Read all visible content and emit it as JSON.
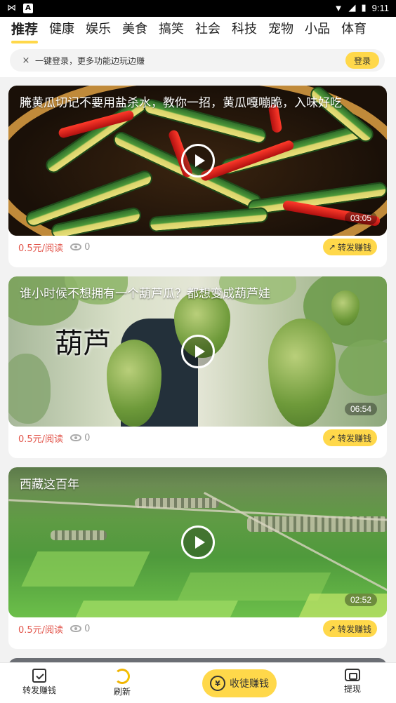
{
  "status_bar": {
    "time": "9:11"
  },
  "tabs": [
    {
      "label": "推荐",
      "active": true
    },
    {
      "label": "健康"
    },
    {
      "label": "娱乐"
    },
    {
      "label": "美食"
    },
    {
      "label": "搞笑"
    },
    {
      "label": "社会"
    },
    {
      "label": "科技"
    },
    {
      "label": "宠物"
    },
    {
      "label": "小品"
    },
    {
      "label": "体育"
    }
  ],
  "login_banner": {
    "close": "×",
    "text": "一键登录，更多功能边玩边赚",
    "button": "登录"
  },
  "cards": [
    {
      "title": "腌黄瓜切记不要用盐杀水，教你一招，黄瓜嘎嘣脆，入味好吃",
      "duration": "03:05",
      "price": "0.5元/阅读",
      "views": "0",
      "share": "转发赚钱"
    },
    {
      "title": "谁小时候不想拥有一个葫芦瓜？都想变成葫芦娃",
      "duration": "06:54",
      "price": "0.5元/阅读",
      "views": "0",
      "share": "转发赚钱",
      "overlay_text": "葫芦"
    },
    {
      "title": "西藏这百年",
      "duration": "02:52",
      "price": "0.5元/阅读",
      "views": "0",
      "share": "转发赚钱"
    }
  ],
  "bottom_nav": {
    "share_earn": "转发赚钱",
    "refresh": "刷新",
    "center": "收徒赚钱",
    "center_icon": "¥",
    "withdraw": "提现"
  },
  "colors": {
    "accent": "#ffd84a",
    "price": "#e2554b"
  }
}
